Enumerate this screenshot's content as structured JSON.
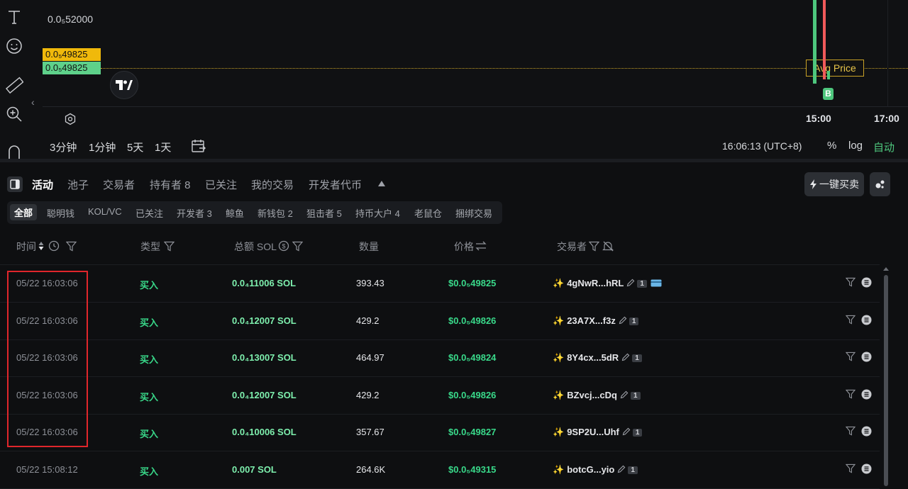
{
  "chart": {
    "price_top": "0.0₅52000",
    "price_tag_yellow": "0.0₅49825",
    "price_tag_green": "0.0₅49825",
    "avg_price_label": "Avg Price",
    "marker_letter": "B",
    "time_15": "15:00",
    "time_17": "17:00",
    "timeframes": [
      "3分钟",
      "1分钟",
      "5天",
      "1天"
    ],
    "clock": "16:06:13 (UTC+8)",
    "percent": "%",
    "log": "log",
    "auto": "自动",
    "colors": {
      "yellow_tag": "#f0b90b",
      "green_tag": "#5ed18a",
      "candle_green": "#4ec77d",
      "candle_red": "#f05a5a"
    }
  },
  "tabs": {
    "activity": "活动",
    "pool": "池子",
    "traders": "交易者",
    "holders": "持有者 8",
    "followed": "已关注",
    "my_trades": "我的交易",
    "dev_tokens": "开发者代币",
    "one_click": "一键买卖"
  },
  "filters": {
    "all": "全部",
    "smart": "聪明钱",
    "kol": "KOL/VC",
    "followed": "已关注",
    "dev": "开发者 3",
    "whale": "鲸鱼",
    "new_wallet": "新钱包 2",
    "sniper": "狙击者 5",
    "top_holder": "持币大户 4",
    "rat": "老鼠仓",
    "bundle": "捆绑交易"
  },
  "headers": {
    "time": "时间",
    "type": "类型",
    "total": "总额 SOL",
    "qty": "数量",
    "price": "价格",
    "trader": "交易者"
  },
  "rows": [
    {
      "time": "05/22 16:03:06",
      "type": "买入",
      "total": "0.0₄11006 SOL",
      "qty": "393.43",
      "price": "$0.0₅49825",
      "trader": "4gNwR...hRL",
      "badge": "1"
    },
    {
      "time": "05/22 16:03:06",
      "type": "买入",
      "total": "0.0₄12007 SOL",
      "qty": "429.2",
      "price": "$0.0₅49826",
      "trader": "23A7X...f3z",
      "badge": "1"
    },
    {
      "time": "05/22 16:03:06",
      "type": "买入",
      "total": "0.0₄13007 SOL",
      "qty": "464.97",
      "price": "$0.0₅49824",
      "trader": "8Y4cx...5dR",
      "badge": "1"
    },
    {
      "time": "05/22 16:03:06",
      "type": "买入",
      "total": "0.0₄12007 SOL",
      "qty": "429.2",
      "price": "$0.0₅49826",
      "trader": "BZvcj...cDq",
      "badge": "1"
    },
    {
      "time": "05/22 16:03:06",
      "type": "买入",
      "total": "0.0₄10006 SOL",
      "qty": "357.67",
      "price": "$0.0₅49827",
      "trader": "9SP2U...Uhf",
      "badge": "1"
    },
    {
      "time": "05/22 15:08:12",
      "type": "买入",
      "total": "0.007 SOL",
      "qty": "264.6K",
      "price": "$0.0₅49315",
      "trader": "botcG...yio",
      "badge": "1"
    }
  ]
}
